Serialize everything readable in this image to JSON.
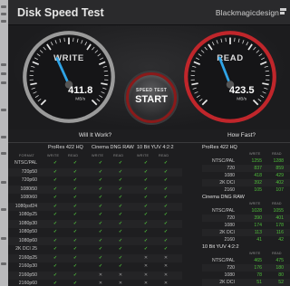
{
  "app": {
    "title": "Disk Speed Test",
    "brand": "Blackmagicdesign"
  },
  "gauges": {
    "write": {
      "label": "WRITE",
      "value": "411.8",
      "unit": "MB/s",
      "level": 0.41,
      "ring_color": "#9a9a9a",
      "needle_color": "#2fa4e7"
    },
    "read": {
      "label": "READ",
      "value": "423.5",
      "unit": "MB/s",
      "level": 0.42,
      "ring_color": "#c0262b",
      "needle_color": "#2fa4e7"
    }
  },
  "start_button": {
    "small": "SPEED TEST",
    "big": "START",
    "ring_color": "#8a1a1a"
  },
  "will_it_work": {
    "title": "Will It Work?",
    "format_header": "FORMAT",
    "write_header": "WRITE",
    "read_header": "READ",
    "codecs": [
      "ProRes 422 HQ",
      "Cinema DNG RAW",
      "10 Bit YUV 4:2:2"
    ],
    "rows": [
      {
        "format": "NTSC/PAL",
        "marks": [
          "✓",
          "✓",
          "✓",
          "✓",
          "✓",
          "✓"
        ]
      },
      {
        "format": "720p50",
        "marks": [
          "✓",
          "✓",
          "✓",
          "✓",
          "✓",
          "✓"
        ]
      },
      {
        "format": "720p60",
        "marks": [
          "✓",
          "✓",
          "✓",
          "✓",
          "✓",
          "✓"
        ]
      },
      {
        "format": "1080i50",
        "marks": [
          "✓",
          "✓",
          "✓",
          "✓",
          "✓",
          "✓"
        ]
      },
      {
        "format": "1080i60",
        "marks": [
          "✓",
          "✓",
          "✓",
          "✓",
          "✓",
          "✓"
        ]
      },
      {
        "format": "1080psf24",
        "marks": [
          "✓",
          "✓",
          "✓",
          "✓",
          "✓",
          "✓"
        ]
      },
      {
        "format": "1080p25",
        "marks": [
          "✓",
          "✓",
          "✓",
          "✓",
          "✓",
          "✓"
        ]
      },
      {
        "format": "1080p30",
        "marks": [
          "✓",
          "✓",
          "✓",
          "✓",
          "✓",
          "✓"
        ]
      },
      {
        "format": "1080p50",
        "marks": [
          "✓",
          "✓",
          "✓",
          "✓",
          "✓",
          "✓"
        ]
      },
      {
        "format": "1080p60",
        "marks": [
          "✓",
          "✓",
          "✓",
          "✓",
          "✓",
          "✓"
        ]
      },
      {
        "format": "2K DCI 25",
        "marks": [
          "✓",
          "✓",
          "✓",
          "✓",
          "✓",
          "✓"
        ]
      },
      {
        "format": "2160p25",
        "marks": [
          "✓",
          "✓",
          "✓",
          "✓",
          "✕",
          "✕"
        ]
      },
      {
        "format": "2160p30",
        "marks": [
          "✓",
          "✓",
          "✓",
          "✓",
          "✕",
          "✕"
        ]
      },
      {
        "format": "2160p50",
        "marks": [
          "✓",
          "✓",
          "✕",
          "✕",
          "✕",
          "✕"
        ]
      },
      {
        "format": "2160p60",
        "marks": [
          "✓",
          "✓",
          "✕",
          "✕",
          "✕",
          "✕"
        ]
      }
    ]
  },
  "how_fast": {
    "title": "How Fast?",
    "write_header": "WRITE",
    "read_header": "READ",
    "groups": [
      {
        "name": "ProRes 422 HQ",
        "rows": [
          {
            "format": "NTSC/PAL",
            "write": "1255",
            "read": "1288"
          },
          {
            "format": "720",
            "write": "837",
            "read": "859"
          },
          {
            "format": "1080",
            "write": "418",
            "read": "429"
          },
          {
            "format": "2K DCI",
            "write": "392",
            "read": "402"
          },
          {
            "format": "2160",
            "write": "105",
            "read": "107"
          }
        ]
      },
      {
        "name": "Cinema DNG RAW",
        "rows": [
          {
            "format": "NTSC/PAL",
            "write": "1028",
            "read": "1055"
          },
          {
            "format": "720",
            "write": "390",
            "read": "401"
          },
          {
            "format": "1080",
            "write": "174",
            "read": "178"
          },
          {
            "format": "2K DCI",
            "write": "113",
            "read": "116"
          },
          {
            "format": "2160",
            "write": "41",
            "read": "42"
          }
        ]
      },
      {
        "name": "10 Bit YUV 4:2:2",
        "rows": [
          {
            "format": "NTSC/PAL",
            "write": "465",
            "read": "475"
          },
          {
            "format": "720",
            "write": "176",
            "read": "180"
          },
          {
            "format": "1080",
            "write": "78",
            "read": "80"
          },
          {
            "format": "2K DCI",
            "write": "51",
            "read": "52"
          },
          {
            "format": "2160",
            "write": "18",
            "read": "19"
          }
        ]
      }
    ]
  }
}
